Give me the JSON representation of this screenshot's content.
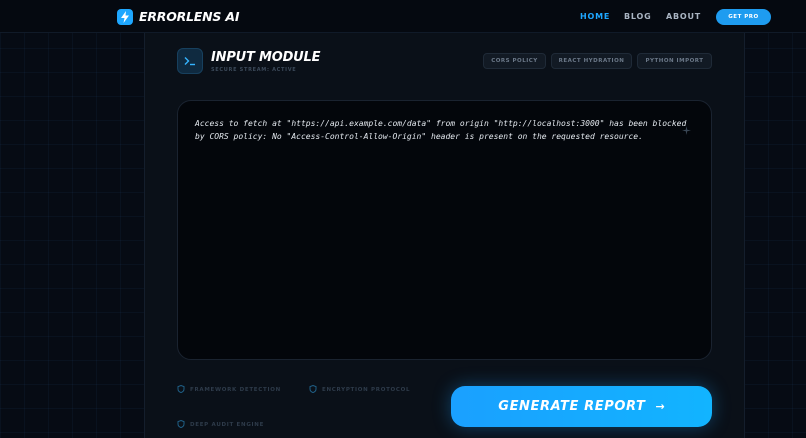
{
  "app": {
    "name": "ERRORLENS AI"
  },
  "nav": {
    "links": [
      "HOME",
      "BLOG",
      "ABOUT"
    ],
    "active": "HOME",
    "cta": "GET PRO"
  },
  "module": {
    "title": "INPUT MODULE",
    "subtitle": "SECURE STREAM: ACTIVE",
    "presets": [
      "CORS POLICY",
      "REACT HYDRATION",
      "PYTHON IMPORT"
    ]
  },
  "editor": {
    "value": "Access to fetch at \"https://api.example.com/data\" from origin \"http://localhost:3000\" has been blocked by CORS policy: No \"Access-Control-Allow-Origin\" header is present on the requested resource."
  },
  "features": [
    "FRAMEWORK DETECTION",
    "ENCRYPTION PROTOCOL",
    "DEEP AUDIT ENGINE"
  ],
  "actions": {
    "generate": "GENERATE REPORT"
  },
  "colors": {
    "accent": "#1ea7ff",
    "background": "#060b14"
  },
  "icons": {
    "logo": "bolt-icon",
    "module": "terminal-icon",
    "editor_corner": "sparkle-icon",
    "features": [
      "shield-icon",
      "shield-icon",
      "shield-icon"
    ],
    "generate": "arrow-right-icon"
  }
}
